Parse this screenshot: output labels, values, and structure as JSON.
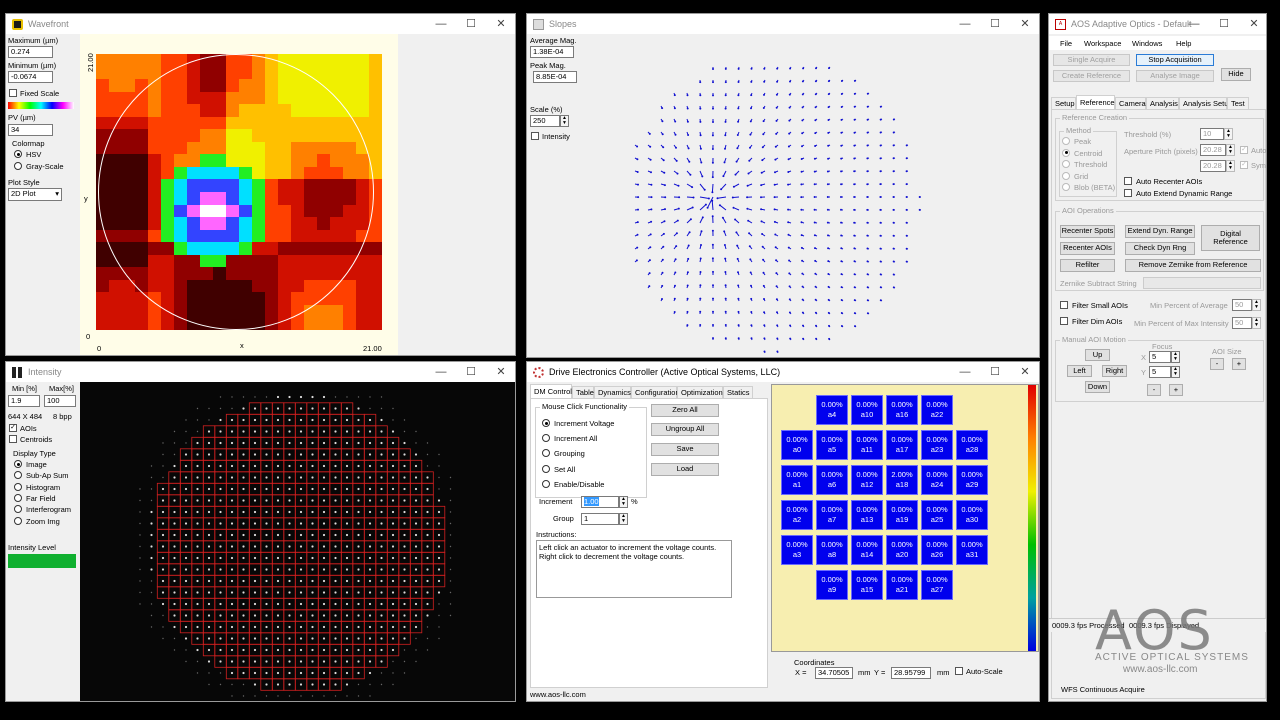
{
  "wavefront": {
    "title": "Wavefront",
    "max_label": "Maximum (µm)",
    "max_value": "0.274",
    "min_label": "Minimum (µm)",
    "min_value": "-0.0674",
    "fixed_scale_label": "Fixed Scale",
    "pv_label": "PV (µm)",
    "pv_value": "34",
    "colormap_label": "Colormap",
    "colormap_options": [
      "HSV",
      "Gray-Scale"
    ],
    "colormap_selected": "HSV",
    "plot_style_label": "Plot Style",
    "plot_style_value": "2D Plot",
    "axis_y_top": "21.00",
    "axis_y_label": "y",
    "axis_y_bottom": "0",
    "axis_x_left": "0",
    "axis_x_label": "x",
    "axis_x_right": "21.00"
  },
  "slopes": {
    "title": "Slopes",
    "avg_label": "Average Mag.",
    "avg_value": "1.38E-04",
    "peak_label": "Peak Mag.",
    "peak_value": "8.85E-04",
    "scale_label": "Scale (%)",
    "scale_value": "250",
    "intensity_label": "Intensity"
  },
  "intensity": {
    "title": "Intensity",
    "min_label": "Min [%]",
    "max_label": "Max[%]",
    "min_value": "1.9",
    "max_value": "100",
    "resolution": "644 X 484",
    "bpp": "8 bpp",
    "aois_label": "AOIs",
    "centroids_label": "Centroids",
    "display_type_label": "Display Type",
    "display_options": [
      "Image",
      "Sub-Ap Sum",
      "Histogram",
      "Far Field",
      "Interferogram",
      "Zoom Img"
    ],
    "display_selected": "Image",
    "level_label": "Intensity Level",
    "level_fraction": 1.0,
    "level_color": "#10b030"
  },
  "dec": {
    "title": "Drive Electronics Controller (Active Optical Systems, LLC)",
    "tabs": [
      "DM Control",
      "Table",
      "Dynamics",
      "Configuration",
      "Optimization",
      "Statics"
    ],
    "active_tab": "DM Control",
    "mouse_group": "Mouse Click Functionality",
    "mouse_options": [
      "Increment Voltage",
      "Increment All",
      "Grouping",
      "Set All",
      "Enable/Disable"
    ],
    "mouse_selected": "Increment Voltage",
    "buttons": [
      "Zero All",
      "Ungroup All",
      "Save",
      "Load"
    ],
    "increment_label": "Increment",
    "increment_value": "1.00",
    "increment_unit": "%",
    "group_label": "Group",
    "group_value": "1",
    "instructions_label": "Instructions:",
    "instructions_text": "Left click an actuator to increment the voltage counts.  Right click to decrement the voltage counts.",
    "actuator_rows": [
      [
        null,
        {
          "v": "0.00%",
          "n": "a4"
        },
        {
          "v": "0.00%",
          "n": "a10"
        },
        {
          "v": "0.00%",
          "n": "a16"
        },
        {
          "v": "0.00%",
          "n": "a22"
        },
        null
      ],
      [
        {
          "v": "0.00%",
          "n": "a0"
        },
        {
          "v": "0.00%",
          "n": "a5"
        },
        {
          "v": "0.00%",
          "n": "a11"
        },
        {
          "v": "0.00%",
          "n": "a17"
        },
        {
          "v": "0.00%",
          "n": "a23"
        },
        {
          "v": "0.00%",
          "n": "a28"
        }
      ],
      [
        {
          "v": "0.00%",
          "n": "a1"
        },
        {
          "v": "0.00%",
          "n": "a6"
        },
        {
          "v": "0.00%",
          "n": "a12"
        },
        {
          "v": "2.00%",
          "n": "a18"
        },
        {
          "v": "0.00%",
          "n": "a24"
        },
        {
          "v": "0.00%",
          "n": "a29"
        }
      ],
      [
        {
          "v": "0.00%",
          "n": "a2"
        },
        {
          "v": "0.00%",
          "n": "a7"
        },
        {
          "v": "0.00%",
          "n": "a13"
        },
        {
          "v": "0.00%",
          "n": "a19"
        },
        {
          "v": "0.00%",
          "n": "a25"
        },
        {
          "v": "0.00%",
          "n": "a30"
        }
      ],
      [
        {
          "v": "0.00%",
          "n": "a3"
        },
        {
          "v": "0.00%",
          "n": "a8"
        },
        {
          "v": "0.00%",
          "n": "a14"
        },
        {
          "v": "0.00%",
          "n": "a20"
        },
        {
          "v": "0.00%",
          "n": "a26"
        },
        {
          "v": "0.00%",
          "n": "a31"
        }
      ],
      [
        null,
        {
          "v": "0.00%",
          "n": "a9"
        },
        {
          "v": "0.00%",
          "n": "a15"
        },
        {
          "v": "0.00%",
          "n": "a21"
        },
        {
          "v": "0.00%",
          "n": "a27"
        },
        null
      ]
    ],
    "coords_label": "Coordinates",
    "x_label": "X =",
    "x_value": "34.70505",
    "x_unit": "mm",
    "y_label": "Y =",
    "y_value": "28.95799",
    "y_unit": "mm",
    "autoscale_label": "Auto-Scale",
    "footer_url": "www.aos-llc.com"
  },
  "aos": {
    "title": "AOS Adaptive Optics - Default",
    "menu": [
      "File",
      "Workspace",
      "Windows",
      "Help"
    ],
    "single_acquire": "Single Acquire",
    "stop_acquisition": "Stop Acquisition",
    "create_reference": "Create Reference",
    "analyse_image": "Analyse Image",
    "hide": "Hide",
    "tabs": [
      "Setup",
      "Reference",
      "Camera",
      "Analysis",
      "Analysis Setup",
      "Test"
    ],
    "active_tab": "Reference",
    "ref_creation_label": "Reference Creation",
    "method_label": "Method",
    "methods": [
      "Peak",
      "Centroid",
      "Threshold",
      "Grid",
      "Blob (BETA)"
    ],
    "method_selected": "Centroid",
    "threshold_label": "Threshold (%)",
    "threshold_value": "10",
    "aperture_label": "Aperture Pitch (pixels)",
    "aperture_x": "20.28",
    "aperture_y": "20.28",
    "auto_label": "Auto",
    "sym_label": "Sym.",
    "auto_recenter": "Auto Recenter AOIs",
    "auto_extend": "Auto Extend Dynamic Range",
    "aoi_ops_label": "AOI Operations",
    "recenter_spots": "Recenter Spots",
    "extend_dyn": "Extend Dyn. Range",
    "digital_ref": "Digital Reference",
    "recenter_aois": "Recenter AOIs",
    "check_dyn": "Check Dyn Rng",
    "refilter": "Refilter",
    "remove_zernike": "Remove Zernike from Reference",
    "zernike_subtract": "Zernike Subtract String",
    "filter_small": "Filter Small AOIs",
    "min_avg_label": "Min Percent of Average",
    "min_avg_value": "50",
    "filter_dim": "Filter Dim AOIs",
    "min_max_label": "Min Percent of Max Intensity",
    "min_max_value": "50",
    "manual_label": "Manual AOI Motion",
    "up": "Up",
    "left": "Left",
    "right": "Right",
    "down": "Down",
    "focus_label": "Focus",
    "focus_x_label": "X",
    "focus_x": "5",
    "focus_y_label": "Y",
    "focus_y": "5",
    "minus": "-",
    "plus": "+",
    "aoi_size_label": "AOI Size",
    "status_left": "0009.3 fps Processed",
    "status_right": "0009.3 fps Displayed",
    "footer": "WFS Continuous Acquire",
    "logo_text": "AOS",
    "logo_company": "ACTIVE OPTICAL SYSTEMS",
    "logo_url": "www.aos-llc.com"
  },
  "colors": {
    "dm_button": "#0000ee",
    "dm_bg": "#f7eeb0",
    "arrow": "#1010d0",
    "grid_red": "#d02020",
    "accent_blue": "#2a7bd6"
  }
}
